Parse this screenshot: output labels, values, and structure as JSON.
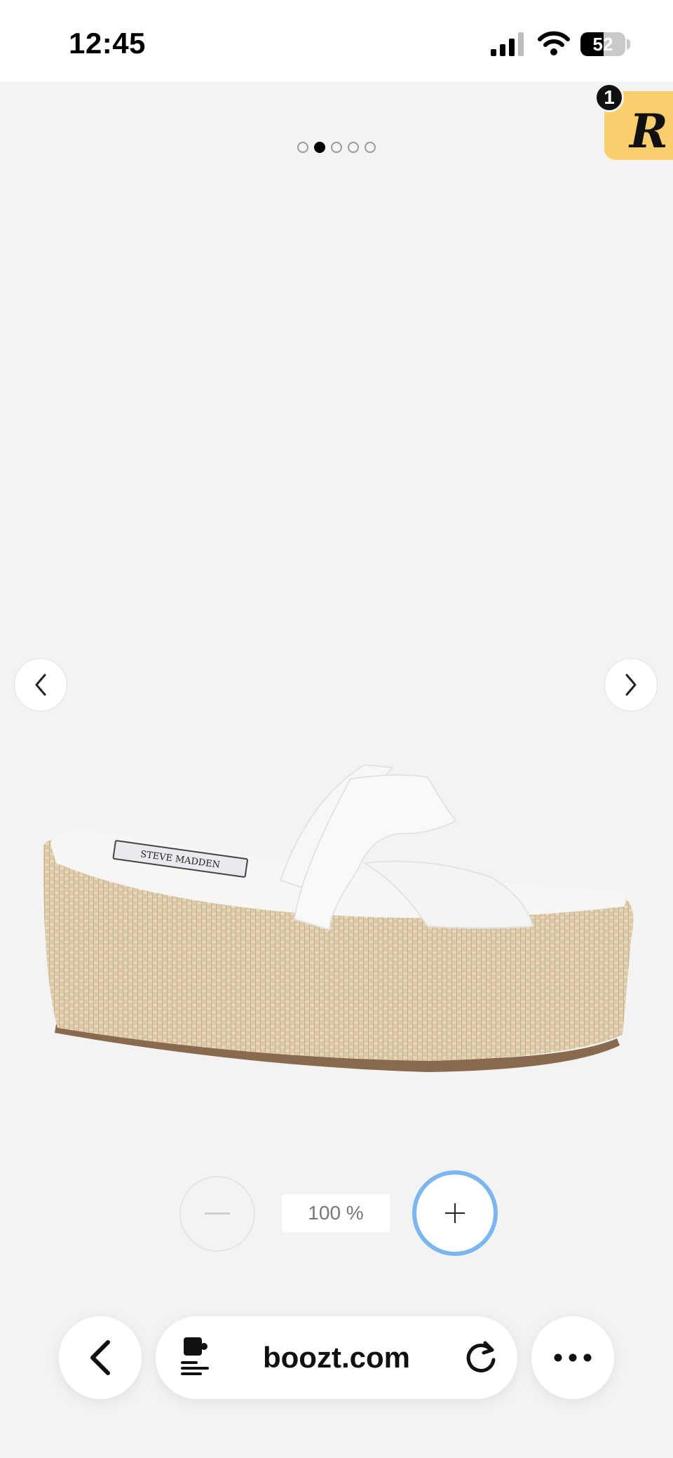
{
  "status_bar": {
    "time": "12:45",
    "battery_level": "52",
    "battery_fraction": 0.52,
    "icons": [
      "cellular-signal-icon",
      "wifi-icon",
      "battery-icon"
    ]
  },
  "gallery": {
    "image_count": 5,
    "active_index": 1,
    "prev_icon": "chevron-left-icon",
    "next_icon": "chevron-right-icon",
    "product_label_text": "STEVE MADDEN"
  },
  "extension_badge": {
    "count": "1",
    "letter": "R",
    "color": "#f8cf6c"
  },
  "zoom": {
    "level": "100 %",
    "minus_icon": "minus-icon",
    "plus_icon": "plus-icon",
    "focus_color": "#7bb6ee"
  },
  "browser_toolbar": {
    "url": "boozt.com",
    "back_icon": "back-arrow-icon",
    "site_settings_icon": "site-settings-icon",
    "reload_icon": "reload-icon",
    "more_icon": "more-icon"
  }
}
